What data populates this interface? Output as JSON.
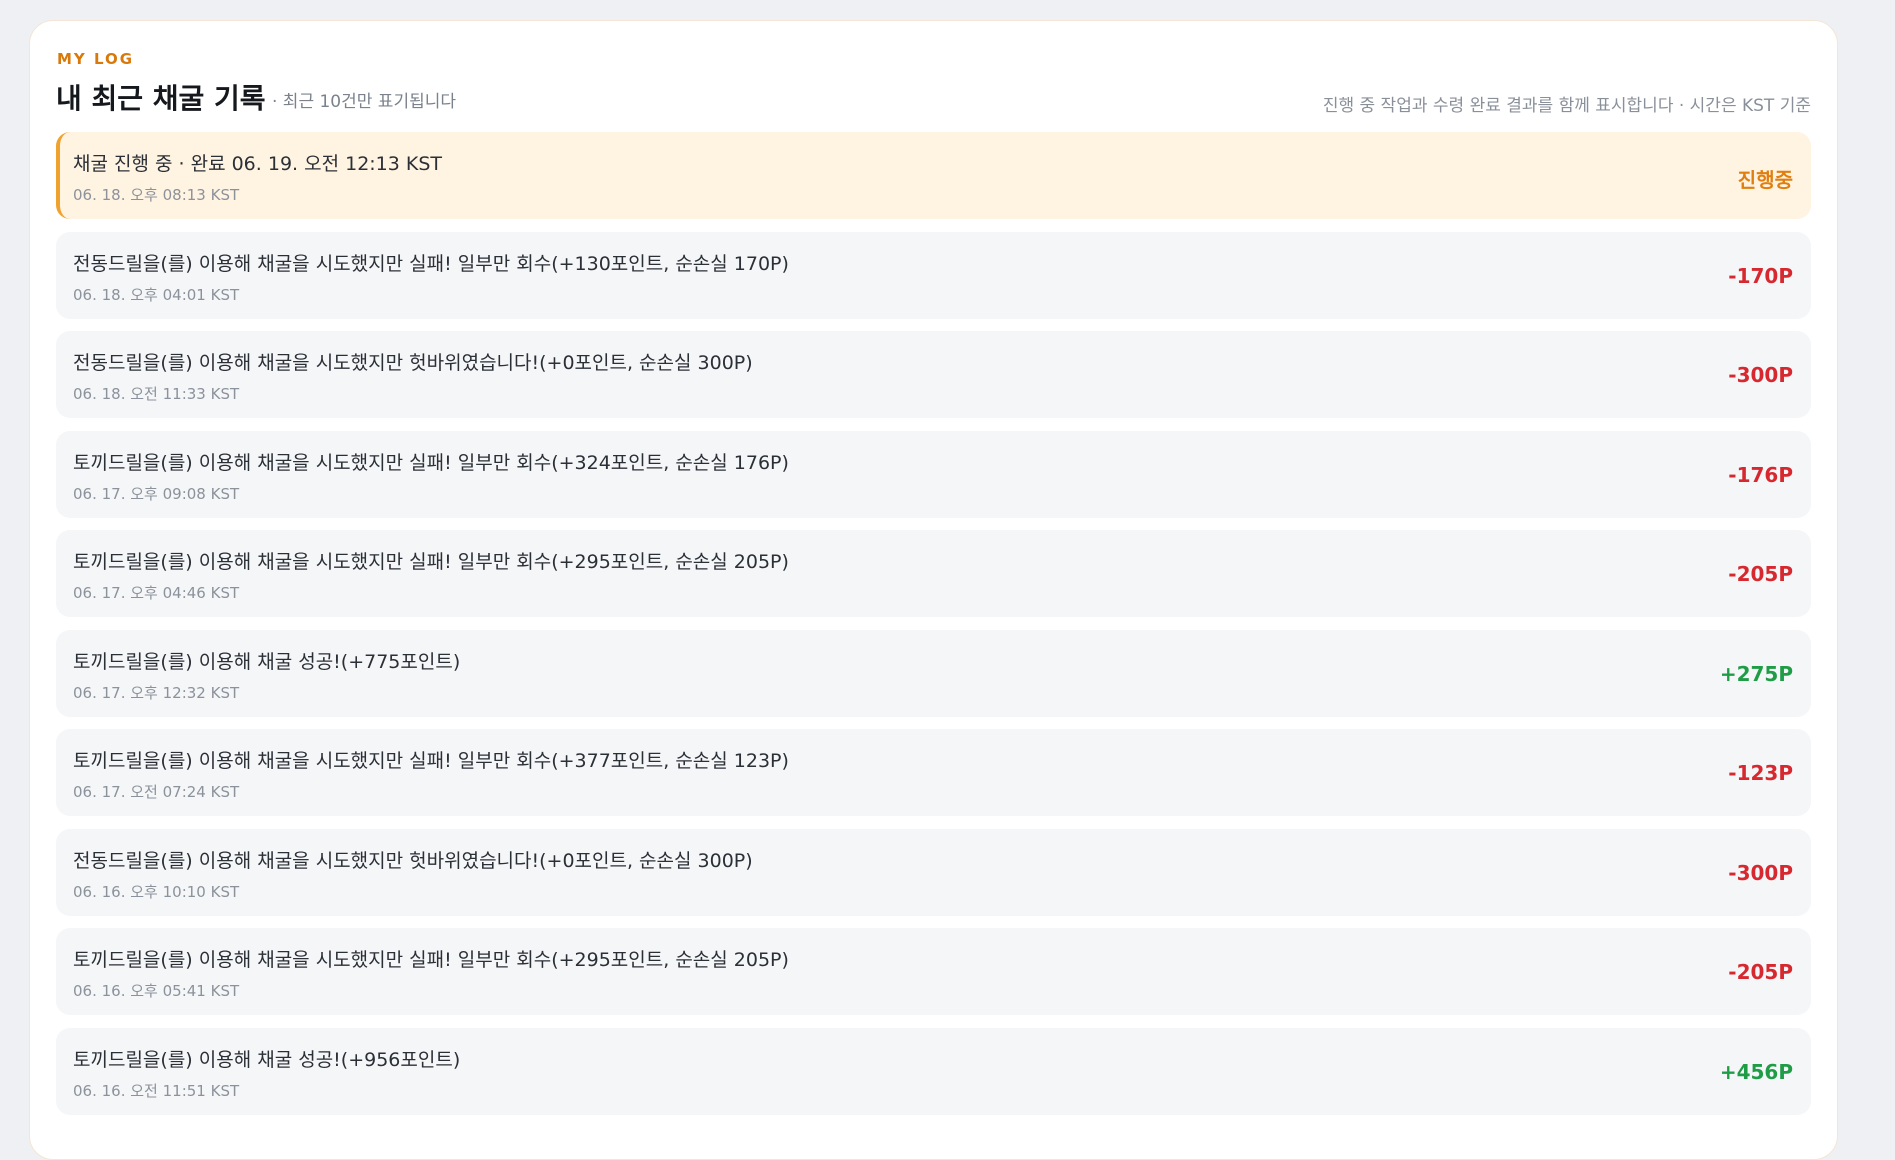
{
  "header": {
    "eyebrow": "MY LOG",
    "title": "내 최근 채굴 기록",
    "subtitle": "· 최근 10건만 표기됩니다",
    "note": "진행 중 작업과 수령 완료 결과를 함께 표시합니다 · 시간은 KST 기준"
  },
  "colors": {
    "accent": "#d9790b",
    "pending_bg": "#fff3e2",
    "pending_border": "#f0a22e",
    "loss": "#d6282e",
    "gain": "#1f9d46"
  },
  "logs": [
    {
      "status": "pending",
      "text": "채굴 진행 중 · 완료 06. 19. 오전 12:13 KST",
      "time": "06. 18. 오후 08:13 KST",
      "amount": "진행중"
    },
    {
      "status": "loss",
      "text": "전동드릴을(를) 이용해 채굴을 시도했지만 실패! 일부만 회수(+130포인트, 순손실 170P)",
      "time": "06. 18. 오후 04:01 KST",
      "amount": "-170P"
    },
    {
      "status": "loss",
      "text": "전동드릴을(를) 이용해 채굴을 시도했지만 헛바위였습니다!(+0포인트, 순손실 300P)",
      "time": "06. 18. 오전 11:33 KST",
      "amount": "-300P"
    },
    {
      "status": "loss",
      "text": "토끼드릴을(를) 이용해 채굴을 시도했지만 실패! 일부만 회수(+324포인트, 순손실 176P)",
      "time": "06. 17. 오후 09:08 KST",
      "amount": "-176P"
    },
    {
      "status": "loss",
      "text": "토끼드릴을(를) 이용해 채굴을 시도했지만 실패! 일부만 회수(+295포인트, 순손실 205P)",
      "time": "06. 17. 오후 04:46 KST",
      "amount": "-205P"
    },
    {
      "status": "gain",
      "text": "토끼드릴을(를) 이용해 채굴 성공!(+775포인트)",
      "time": "06. 17. 오후 12:32 KST",
      "amount": "+275P"
    },
    {
      "status": "loss",
      "text": "토끼드릴을(를) 이용해 채굴을 시도했지만 실패! 일부만 회수(+377포인트, 순손실 123P)",
      "time": "06. 17. 오전 07:24 KST",
      "amount": "-123P"
    },
    {
      "status": "loss",
      "text": "전동드릴을(를) 이용해 채굴을 시도했지만 헛바위였습니다!(+0포인트, 순손실 300P)",
      "time": "06. 16. 오후 10:10 KST",
      "amount": "-300P"
    },
    {
      "status": "loss",
      "text": "토끼드릴을(를) 이용해 채굴을 시도했지만 실패! 일부만 회수(+295포인트, 순손실 205P)",
      "time": "06. 16. 오후 05:41 KST",
      "amount": "-205P"
    },
    {
      "status": "gain",
      "text": "토끼드릴을(를) 이용해 채굴 성공!(+956포인트)",
      "time": "06. 16. 오전 11:51 KST",
      "amount": "+456P"
    }
  ]
}
